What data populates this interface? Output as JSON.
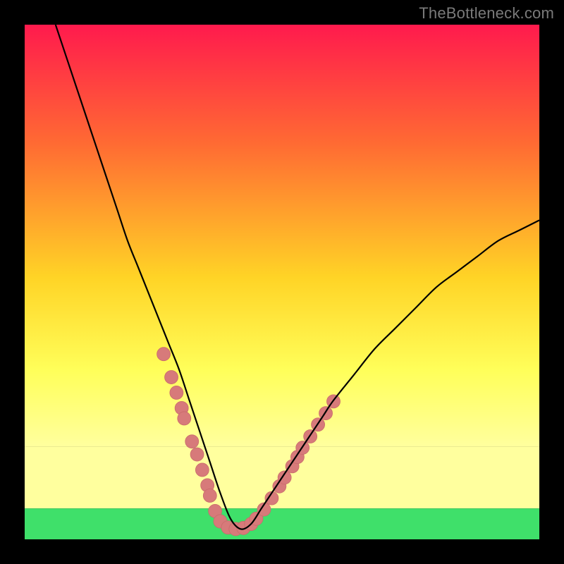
{
  "watermark": "TheBottleneck.com",
  "colors": {
    "black": "#000000",
    "watermark_text": "#7a7a7a",
    "curve": "#000000",
    "marker_fill": "#d77a7a",
    "marker_stroke": "#c96b6b",
    "grad_top": "#ff1a4d",
    "grad_upper": "#ff6a33",
    "grad_mid": "#ffd426",
    "grad_pale": "#ffff9e",
    "grad_green": "#3fe06a"
  },
  "chart_data": {
    "type": "line",
    "title": "",
    "xlabel": "",
    "ylabel": "",
    "xlim": [
      0,
      100
    ],
    "ylim": [
      0,
      100
    ],
    "green_band_y": [
      0,
      6
    ],
    "pale_band_y": [
      6,
      18
    ],
    "gradient_stops": [
      {
        "offset": 0,
        "color": "#ff1a4d"
      },
      {
        "offset": 28,
        "color": "#ff6a33"
      },
      {
        "offset": 60,
        "color": "#ffd426"
      },
      {
        "offset": 82,
        "color": "#ffff5a"
      },
      {
        "offset": 100,
        "color": "#ffff9e"
      }
    ],
    "series": [
      {
        "name": "bottleneck-curve",
        "x": [
          6,
          8,
          10,
          12,
          14,
          16,
          18,
          20,
          22,
          24,
          26,
          28,
          30,
          32,
          34,
          36,
          38,
          40,
          42,
          44,
          46,
          48,
          50,
          52,
          54,
          56,
          58,
          60,
          64,
          68,
          72,
          76,
          80,
          84,
          88,
          92,
          96,
          100
        ],
        "values": [
          100,
          94,
          88,
          82,
          76,
          70,
          64,
          58,
          53,
          48,
          43,
          38,
          33,
          27,
          21,
          15,
          9,
          4,
          2,
          3,
          6,
          9,
          12,
          15,
          18,
          21,
          24,
          27,
          32,
          37,
          41,
          45,
          49,
          52,
          55,
          58,
          60,
          62
        ]
      }
    ],
    "markers": [
      {
        "x": 27.0,
        "y": 36.0
      },
      {
        "x": 28.5,
        "y": 31.5
      },
      {
        "x": 29.5,
        "y": 28.5
      },
      {
        "x": 30.5,
        "y": 25.5
      },
      {
        "x": 31.0,
        "y": 23.5
      },
      {
        "x": 32.5,
        "y": 19.0
      },
      {
        "x": 33.5,
        "y": 16.5
      },
      {
        "x": 34.5,
        "y": 13.5
      },
      {
        "x": 35.5,
        "y": 10.5
      },
      {
        "x": 36.0,
        "y": 8.5
      },
      {
        "x": 37.0,
        "y": 5.5
      },
      {
        "x": 38.0,
        "y": 3.5
      },
      {
        "x": 39.5,
        "y": 2.3
      },
      {
        "x": 41.0,
        "y": 2.0
      },
      {
        "x": 42.5,
        "y": 2.2
      },
      {
        "x": 44.0,
        "y": 3.0
      },
      {
        "x": 45.0,
        "y": 4.0
      },
      {
        "x": 46.5,
        "y": 5.8
      },
      {
        "x": 48.0,
        "y": 8.0
      },
      {
        "x": 49.5,
        "y": 10.3
      },
      {
        "x": 50.5,
        "y": 12.0
      },
      {
        "x": 52.0,
        "y": 14.2
      },
      {
        "x": 53.0,
        "y": 16.0
      },
      {
        "x": 54.0,
        "y": 17.8
      },
      {
        "x": 55.5,
        "y": 20.0
      },
      {
        "x": 57.0,
        "y": 22.3
      },
      {
        "x": 58.5,
        "y": 24.5
      },
      {
        "x": 60.0,
        "y": 26.8
      }
    ],
    "marker_radius_frac": 0.013
  }
}
